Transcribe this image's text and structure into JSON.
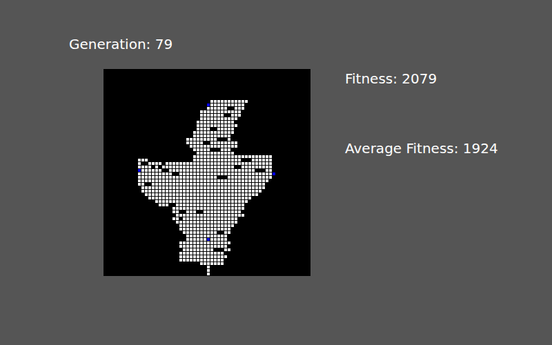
{
  "header": {
    "generation_label": "Generation: 79"
  },
  "stats": [
    {
      "label": "Fitness: 2079"
    },
    {
      "label": "Average Fitness: 1924"
    }
  ],
  "grid": {
    "rows": [
      "",
      "",
      "",
      "",
      "",
      "",
      "",
      "",
      "",
      "...............................###########",
      "..............................B##########",
      "..............................######..###",
      "............................############",
      "............................#######..###",
      "............................###########",
      "...........................###########",
      "...........................############",
      "...........................####..#####",
      "..........................############",
      "..........................###########",
      "........................#########...#",
      "........................#####..########",
      ".........................##############",
      "..........................#####...###",
      "...........................###########",
      "..........................#######################",
      "..........###.............##############...######",
      "..........#..####.###############################",
      "..........####.#.#####################..#########",
      "..........B######..#########################...##",
      "..........##########..###########################B",
      "..........#######################...#############",
      "..........######################################",
      "..........##..#################################",
      "...........####################################",
      "...........###################################",
      "............#################################",
      ".............##############################",
      "...............###########################",
      "................###..####################",
      "....................#####################",
      "....................##..###..###########",
      ".....................####################",
      "....................##.################",
      ".....................##################",
      "......................################",
      "......................###############",
      ".......................##########..##",
      "........................############",
      "........................######B#####",
      "......................###############",
      "......................##############",
      ".......................#########...##",
      "......................#############",
      "......................##############",
      "......................#############",
      "............................#######",
      "..............................#",
      "..............................#",
      "..............................#"
    ]
  }
}
